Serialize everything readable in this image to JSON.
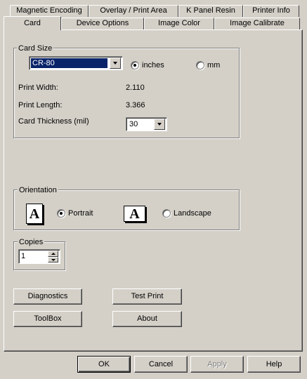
{
  "tabs": {
    "row1": [
      "Magnetic Encoding",
      "Overlay / Print Area",
      "K Panel Resin",
      "Printer Info"
    ],
    "row2": [
      "Card",
      "Device Options",
      "Image Color",
      "Image Calibrate"
    ],
    "active": "Card"
  },
  "card_size": {
    "title": "Card Size",
    "selected": "CR-80",
    "unit_inches": "inches",
    "unit_mm": "mm",
    "selected_unit": "inches",
    "print_width_label": "Print Width:",
    "print_width_value": "2.110",
    "print_length_label": "Print Length:",
    "print_length_value": "3.366",
    "thickness_label": "Card Thickness (mil)",
    "thickness_value": "30"
  },
  "orientation": {
    "title": "Orientation",
    "portrait_label": "Portrait",
    "landscape_label": "Landscape",
    "icon_glyph": "A",
    "selected": "Portrait"
  },
  "copies": {
    "title": "Copies",
    "value": "1"
  },
  "tools": {
    "diagnostics": "Diagnostics",
    "test_print": "Test Print",
    "toolbox": "ToolBox",
    "about": "About"
  },
  "footer": {
    "ok": "OK",
    "cancel": "Cancel",
    "apply": "Apply",
    "help": "Help"
  },
  "colors": {
    "dialog_bg": "#d4d0c8",
    "selection_bg": "#0a246a"
  }
}
